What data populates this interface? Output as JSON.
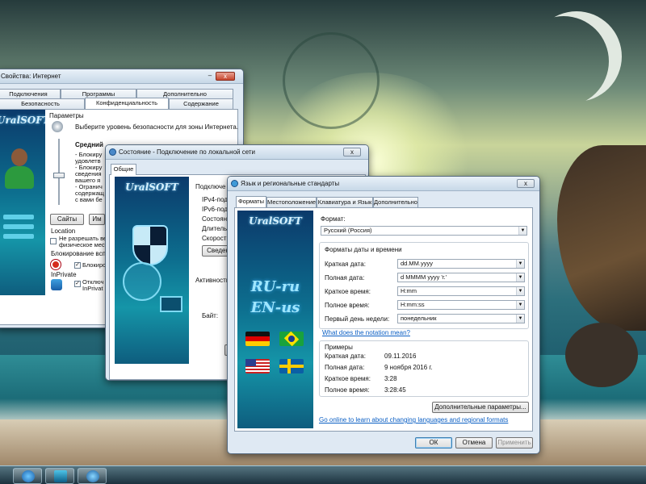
{
  "ie_window": {
    "title": "Свойства: Интернет",
    "tabs_row1": [
      "Подключения",
      "Программы",
      "Дополнительно"
    ],
    "tabs_row2": [
      "Безопасность",
      "Конфиденциальность",
      "Содержание"
    ],
    "brand": "UralSOFT",
    "params_title": "Параметры",
    "params_desc": "Выберите уровень безопасности для зоны Интернета.",
    "level": "Средний",
    "level_lines": [
      "- Блокиру",
      "удовлетв",
      "- Блокиру",
      "сведения",
      "вашего я",
      "- Огранич",
      "содержащ",
      "с вами бе"
    ],
    "sites_button": "Сайты",
    "import_button": "Им",
    "location_title": "Location",
    "location_check_line1": "Не разрешать ве",
    "location_check_line2": "физическое мест",
    "popup_title": "Блокирование всплы",
    "popup_check": "Блокиро",
    "inprivate_title": "InPrivate",
    "inprivate_check_line1": "Отключ",
    "inprivate_check_line2": "InPrivat"
  },
  "status_window": {
    "title": "Состояние - Подключение по локальной сети",
    "tab": "Общие",
    "brand": "UralSOFT",
    "rows": [
      "Подключе",
      "IPv4-подк",
      "IPv6-подк",
      "Состояни",
      "Длительн",
      "Скорость:"
    ],
    "details_button": "Сведен",
    "activity_label": "Активность",
    "bytes_label": "Байт:",
    "bottom_button": "С"
  },
  "region_window": {
    "title": "Язык и региональные стандарты",
    "tabs": [
      "Форматы",
      "Местоположение",
      "Клавиатура и Язык",
      "Дополнительно"
    ],
    "brand": "UralSOFT",
    "big_ru": "RU-ru",
    "big_en": "EN-us",
    "format_label": "Формат:",
    "format_value": "Русский (Россия)",
    "datetime_group": "Форматы даты и времени",
    "datetime_rows": [
      {
        "label": "Краткая дата:",
        "value": "dd.MM.yyyy"
      },
      {
        "label": "Полная дата:",
        "value": "d MMMM yyyy 'г.'"
      },
      {
        "label": "Краткое время:",
        "value": "H:mm"
      },
      {
        "label": "Полное время:",
        "value": "H:mm:ss"
      },
      {
        "label": "Первый день недели:",
        "value": "понедельник"
      }
    ],
    "notation_link": "What does the notation mean?",
    "examples_group": "Примеры",
    "examples": [
      {
        "label": "Краткая дата:",
        "value": "09.11.2016"
      },
      {
        "label": "Полная дата:",
        "value": "9 ноября 2016 г."
      },
      {
        "label": "Краткое время:",
        "value": "3:28"
      },
      {
        "label": "Полное время:",
        "value": "3:28:45"
      }
    ],
    "additional_button": "Дополнительные параметры...",
    "online_link": "Go online to learn about changing languages and regional formats",
    "ok_button": "ОК",
    "cancel_button": "Отмена",
    "apply_button": "Применить",
    "close_glyph": "x",
    "dropdown_glyph": "▼"
  },
  "colors": {
    "branding_panel": "#0d6f8f",
    "link": "#0b5fc4",
    "window_frame": "#dfe9f3"
  }
}
